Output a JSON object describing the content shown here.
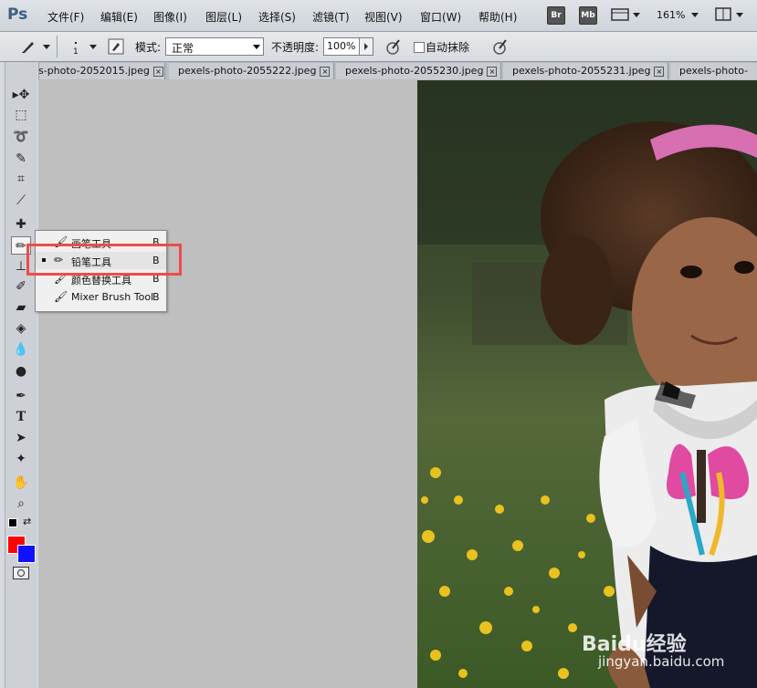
{
  "app": {
    "logo": "Ps"
  },
  "menu": [
    {
      "label": "文件(F)"
    },
    {
      "label": "编辑(E)"
    },
    {
      "label": "图像(I)"
    },
    {
      "label": "图层(L)"
    },
    {
      "label": "选择(S)"
    },
    {
      "label": "滤镜(T)"
    },
    {
      "label": "视图(V)"
    },
    {
      "label": "窗口(W)"
    },
    {
      "label": "帮助(H)"
    }
  ],
  "appbar": {
    "bridge": "Br",
    "minibridge": "Mb",
    "zoom": "161%"
  },
  "options": {
    "brush_size": "1",
    "mode_label": "模式:",
    "mode_value": "正常",
    "opacity_label": "不透明度:",
    "opacity_value": "100%",
    "auto_erase_label": "自动抹除"
  },
  "tabs": [
    {
      "label": "s-photo-2052015.jpeg"
    },
    {
      "label": "pexels-photo-2055222.jpeg"
    },
    {
      "label": "pexels-photo-2055230.jpeg"
    },
    {
      "label": "pexels-photo-2055231.jpeg"
    },
    {
      "label": "pexels-photo-"
    }
  ],
  "flyout": {
    "items": [
      {
        "label": "画笔工具",
        "shortcut": "B"
      },
      {
        "label": "铅笔工具",
        "shortcut": "B",
        "selected": true
      },
      {
        "label": "颜色替换工具",
        "shortcut": "B"
      },
      {
        "label": "Mixer Brush Tool",
        "shortcut": "B"
      }
    ]
  },
  "colors": {
    "foreground": "#ff0000",
    "background": "#1010ff",
    "highlight": "#f04a4a"
  },
  "watermark": {
    "logo": "Baidu经验",
    "url": "jingyan.baidu.com"
  }
}
